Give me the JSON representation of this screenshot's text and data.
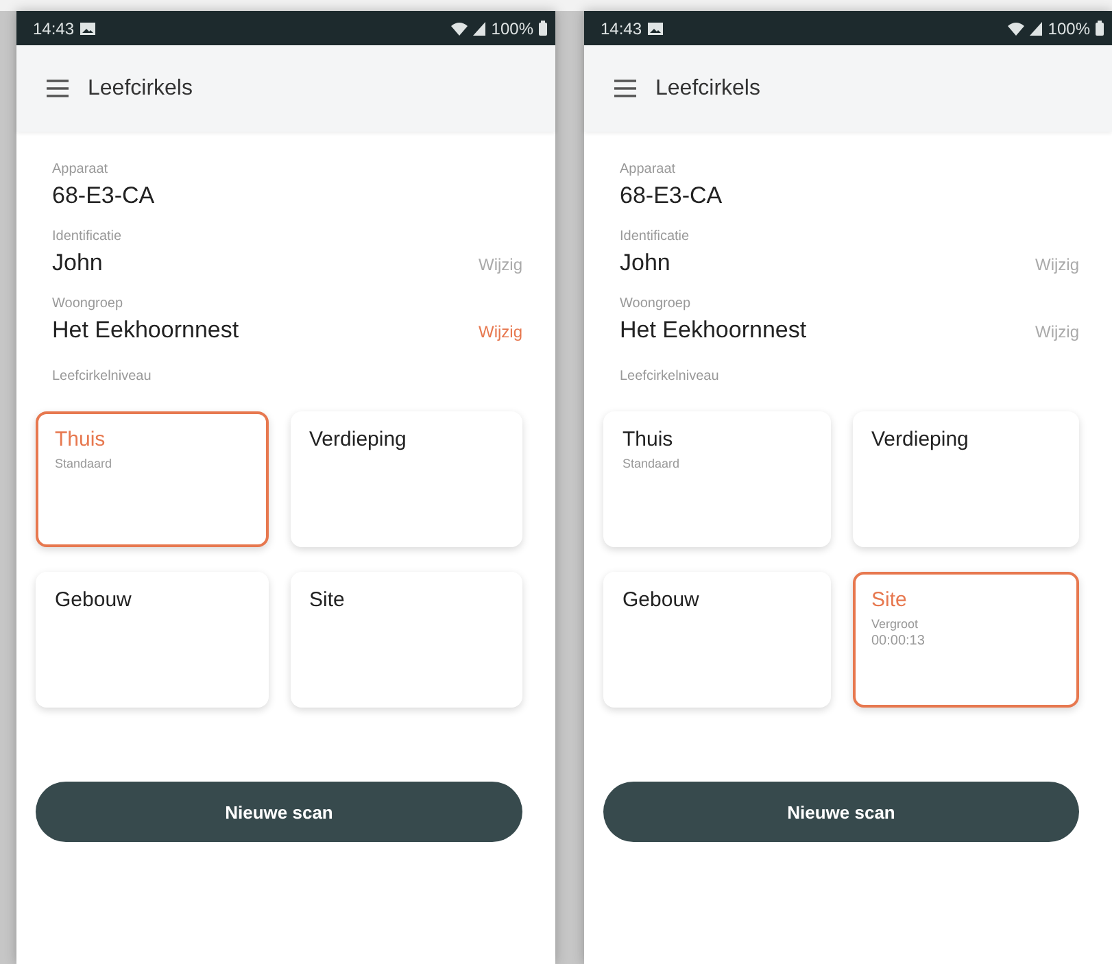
{
  "screens": [
    {
      "status_bar": {
        "time": "14:43",
        "battery": "100%"
      },
      "app_bar": {
        "title": "Leefcirkels"
      },
      "fields": [
        {
          "label": "Apparaat",
          "value": "68-E3-CA"
        },
        {
          "label": "Identificatie",
          "value": "John",
          "action": {
            "label": "Wijzig",
            "highlighted": false
          }
        },
        {
          "label": "Woongroep",
          "value": "Het Eekhoornnest",
          "action": {
            "label": "Wijzig",
            "highlighted": true
          }
        }
      ],
      "level_label": "Leefcirkelniveau",
      "levels": [
        {
          "title": "Thuis",
          "lines": [
            "Standaard"
          ],
          "selected": true
        },
        {
          "title": "Verdieping",
          "selected": false
        },
        {
          "title": "Gebouw",
          "selected": false
        },
        {
          "title": "Site",
          "selected": false
        }
      ],
      "button": "Nieuwe scan"
    },
    {
      "status_bar": {
        "time": "14:43",
        "battery": "100%"
      },
      "app_bar": {
        "title": "Leefcirkels"
      },
      "fields": [
        {
          "label": "Apparaat",
          "value": "68-E3-CA"
        },
        {
          "label": "Identificatie",
          "value": "John",
          "action": {
            "label": "Wijzig",
            "highlighted": false
          }
        },
        {
          "label": "Woongroep",
          "value": "Het Eekhoornnest",
          "action": {
            "label": "Wijzig",
            "highlighted": false
          }
        }
      ],
      "level_label": "Leefcirkelniveau",
      "levels": [
        {
          "title": "Thuis",
          "lines": [
            "Standaard"
          ],
          "selected": false
        },
        {
          "title": "Verdieping",
          "selected": false
        },
        {
          "title": "Gebouw",
          "selected": false
        },
        {
          "title": "Site",
          "lines": [
            "Vergroot",
            "00:00:13"
          ],
          "selected": true
        }
      ],
      "button": "Nieuwe scan"
    }
  ]
}
